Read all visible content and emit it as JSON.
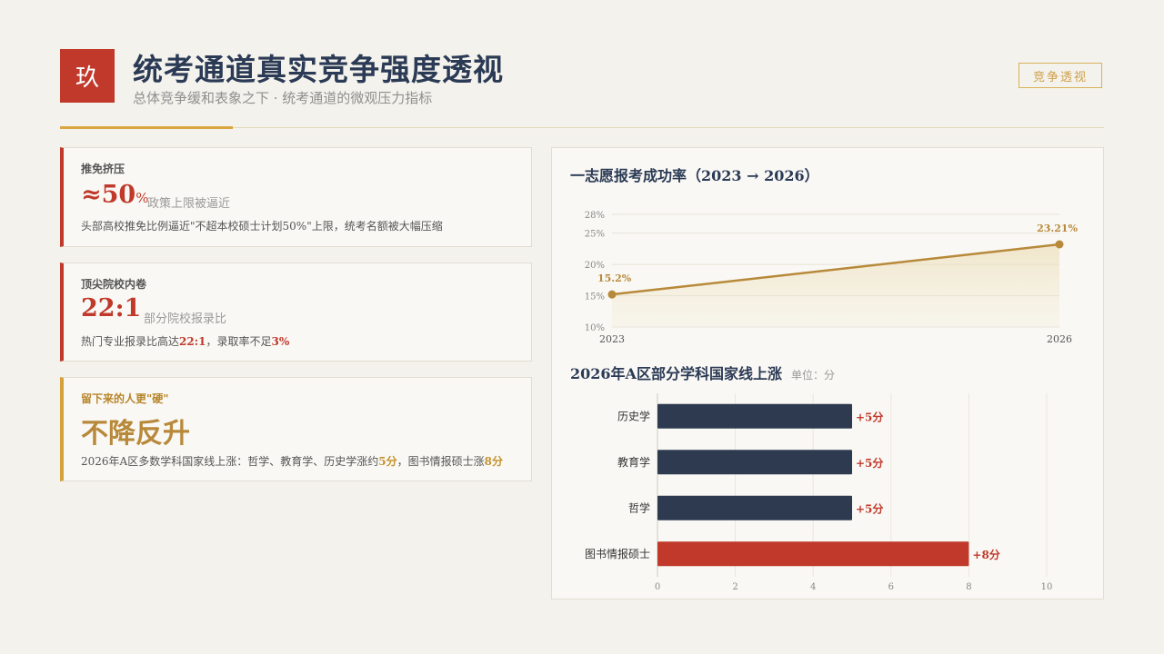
{
  "header": {
    "badge": "玖",
    "title": "统考通道真实竞争强度透视",
    "subtitle": "总体竞争缓和表象之下 · 统考通道的微观压力指标",
    "tag": "竞争透视"
  },
  "cards": [
    {
      "label": "推免挤压",
      "big": "≈50",
      "unit": "%",
      "note": "政策上限被逼近",
      "desc": "头部高校推免比例逼近\"不超本校硕士计划50%\"上限，统考名额被大幅压缩"
    },
    {
      "label": "顶尖院校内卷",
      "big": "22:1",
      "note": "部分院校报录比",
      "desc_prefix": "热门专业报录比高达",
      "desc_hl1": "22:1",
      "desc_mid": "，录取率不足",
      "desc_hl2": "3%"
    },
    {
      "label": "留下来的人更\"硬\"",
      "big": "不降反升",
      "desc_prefix": "2026年A区多数学科国家线上涨：哲学、教育学、历史学涨约",
      "desc_hl1": "5分",
      "desc_mid": "，图书情报硕士涨",
      "desc_hl2": "8分"
    }
  ],
  "colors": {
    "accent_red": "#c0392b",
    "accent_gold": "#b8893a",
    "navy": "#2e3a4f"
  },
  "chart_data": [
    {
      "type": "area",
      "title": "一志愿报考成功率（2023 → 2026）",
      "x": [
        "2023",
        "2026"
      ],
      "values": [
        15.2,
        23.21
      ],
      "data_labels": [
        "15.2%",
        "23.21%"
      ],
      "yticks": [
        "10%",
        "15%",
        "20%",
        "25%",
        "28%"
      ],
      "ytick_values": [
        10,
        15,
        20,
        25,
        28
      ],
      "ylim": [
        10,
        28
      ],
      "grid": true
    },
    {
      "type": "bar",
      "orientation": "horizontal",
      "title": "2026年A区部分学科国家线上涨",
      "unit_label": "单位：分",
      "categories": [
        "历史学",
        "教育学",
        "哲学",
        "图书情报硕士"
      ],
      "values": [
        5,
        5,
        5,
        8
      ],
      "data_labels": [
        "+5分",
        "+5分",
        "+5分",
        "+8分"
      ],
      "xticks": [
        "0",
        "2",
        "4",
        "6",
        "8",
        "10"
      ],
      "xtick_values": [
        0,
        2,
        4,
        6,
        8,
        10
      ],
      "xlim": [
        0,
        10
      ],
      "grid": true
    }
  ]
}
